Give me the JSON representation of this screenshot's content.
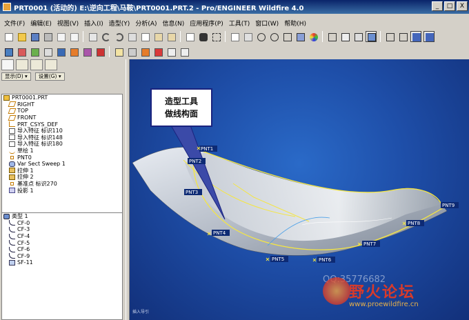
{
  "window": {
    "title": "PRT0001 (活动的) E:\\逆向工程\\马鞍\\PRT0001.PRT.2 - Pro/ENGINEER Wildfire 4.0",
    "minimize": "_",
    "maximize": "□",
    "close": "X"
  },
  "menu": [
    "文件(F)",
    "编辑(E)",
    "视图(V)",
    "插入(I)",
    "造型(Y)",
    "分析(A)",
    "信息(N)",
    "应用程序(P)",
    "工具(T)",
    "窗口(W)",
    "帮助(H)"
  ],
  "left_panel": {
    "display_btn": "显示(D) ▾",
    "settings_btn": "设置(G) ▾",
    "model_tree": [
      {
        "label": "PRT0001.PRT",
        "icon": "part-icon"
      },
      {
        "label": "RIGHT",
        "icon": "datum-plane-icon"
      },
      {
        "label": "TOP",
        "icon": "datum-plane-icon"
      },
      {
        "label": "FRONT",
        "icon": "datum-plane-icon"
      },
      {
        "label": "PRT_CSYS_DEF",
        "icon": "csys-icon"
      },
      {
        "label": "导入特征 标识110",
        "icon": "import-feature-icon"
      },
      {
        "label": "导入特征 标识148",
        "icon": "import-feature-icon"
      },
      {
        "label": "导入特征 标识180",
        "icon": "import-feature-icon"
      },
      {
        "label": "草绘 1",
        "icon": "sketch-icon"
      },
      {
        "label": "PNT0",
        "icon": "datum-point-icon"
      },
      {
        "label": "Var Sect Sweep 1",
        "icon": "sweep-icon"
      },
      {
        "label": "拉伸 1",
        "icon": "extrude-icon"
      },
      {
        "label": "拉伸 2",
        "icon": "extrude-icon"
      },
      {
        "label": "基准点 标识270",
        "icon": "datum-point-icon"
      },
      {
        "label": "投影 1",
        "icon": "projection-icon"
      }
    ],
    "style_tree": [
      {
        "label": "类型 1",
        "icon": "style-icon"
      },
      {
        "label": "CF-0",
        "icon": "curve-icon"
      },
      {
        "label": "CF-3",
        "icon": "curve-icon"
      },
      {
        "label": "CF-4",
        "icon": "curve-icon"
      },
      {
        "label": "CF-5",
        "icon": "curve-icon"
      },
      {
        "label": "CF-6",
        "icon": "curve-icon"
      },
      {
        "label": "CF-9",
        "icon": "curve-icon"
      },
      {
        "label": "SF-11",
        "icon": "surface-icon"
      }
    ]
  },
  "viewport": {
    "callout_line1": "造型工具",
    "callout_line2": "做线构面",
    "points": [
      "PNT1",
      "PNT2",
      "PNT3",
      "PNT4",
      "PNT5",
      "PNT6",
      "PNT7",
      "PNT8",
      "PNT9"
    ],
    "watermark_qq": "QQ:35776682",
    "watermark_logo": "野火论坛",
    "watermark_url": "www.proewildfire.cn",
    "watermark_small": "插入导引"
  },
  "colors": {
    "viewport_bg": "#1e4ea8",
    "curve_yellow": "#f5e642",
    "callout_border": "#1a237e",
    "watermark_red": "#d83a2a"
  }
}
